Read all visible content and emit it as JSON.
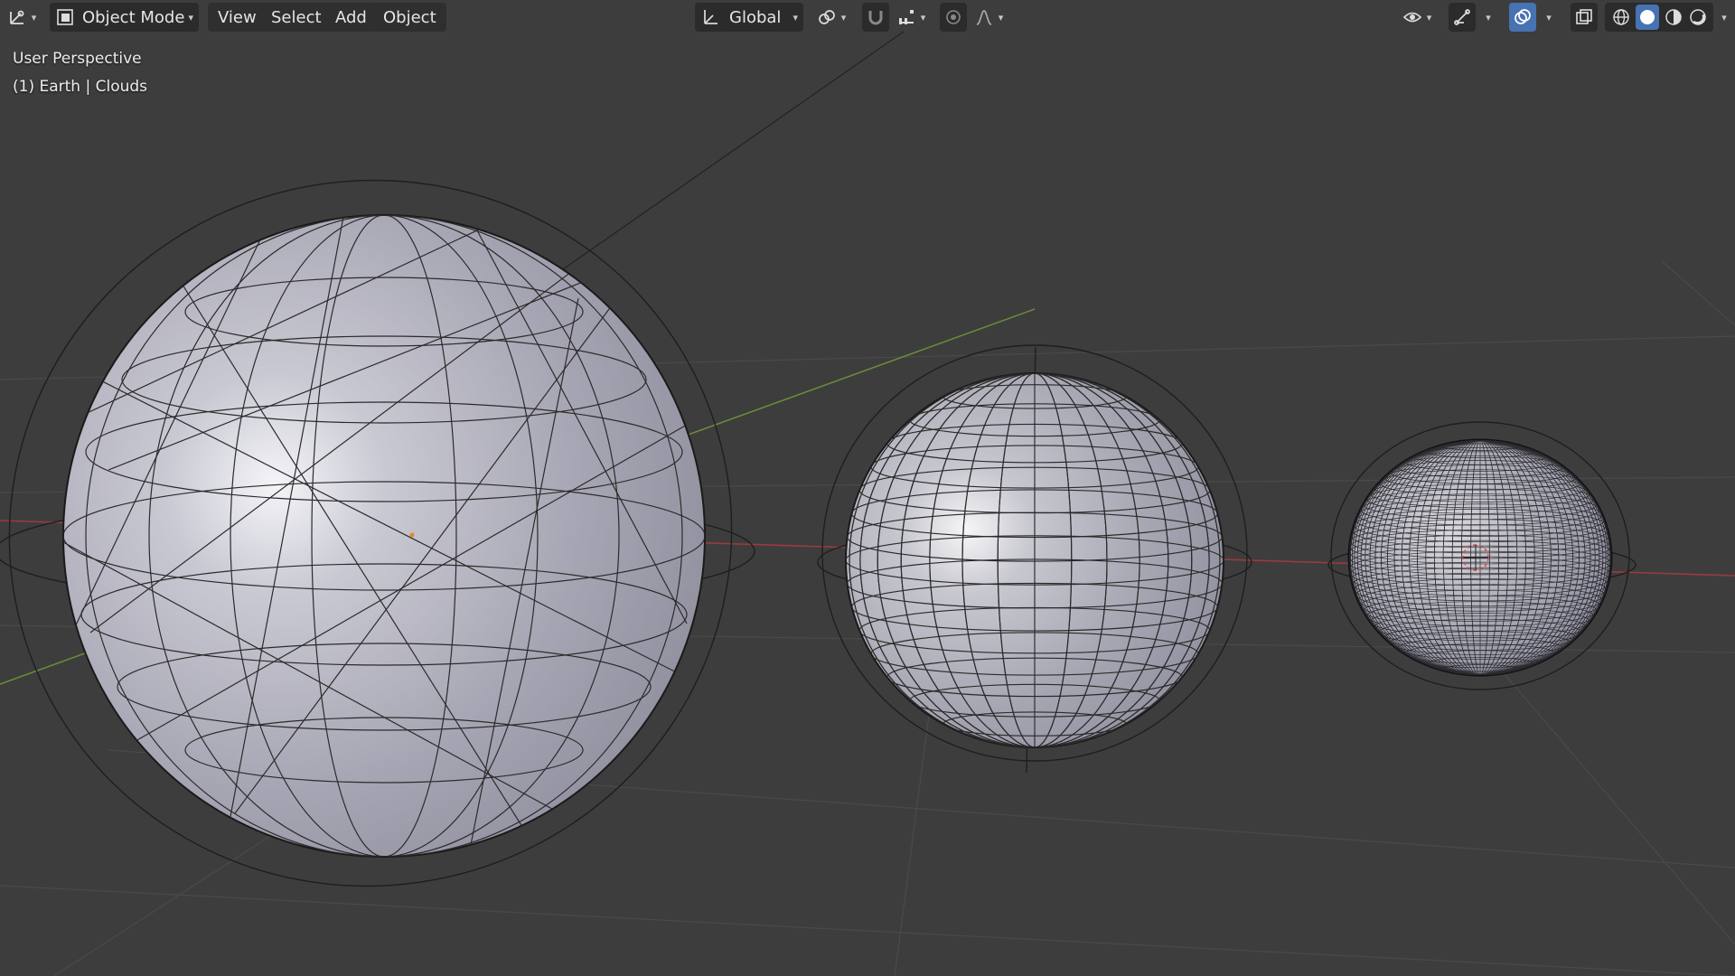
{
  "header": {
    "editor_type_icon": "editor-type-icon",
    "mode": {
      "label": "Object Mode",
      "icon": "object-mode-icon"
    },
    "menus": [
      "View",
      "Select",
      "Add",
      "Object"
    ],
    "orientation": {
      "label": "Global",
      "icon": "transform-orientation-icon"
    },
    "pivot_icon": "pivot-point-icon",
    "snap_icon": "snap-magnet-icon",
    "snap_target_icon": "snap-increment-icon",
    "proportional_icon": "proportional-editing-icon",
    "falloff_icon": "falloff-curve-icon",
    "visibility_icon": "eye-visibility-icon",
    "gizmo_icon": "gizmo-icon",
    "overlays_icon": "overlays-icon",
    "xray_icon": "xray-icon",
    "shading_modes": [
      "wireframe",
      "solid",
      "material-preview",
      "rendered"
    ],
    "active_shading": "solid"
  },
  "viewport": {
    "view_name": "User Perspective",
    "object_info": "(1) Earth | Clouds",
    "colors": {
      "background": "#3d3d3d",
      "x_axis": "#9c3a3f",
      "y_axis": "#6b8e3a",
      "sphere": "#b8b8c4",
      "wire": "#2a2a2a",
      "accent": "#4772b3"
    },
    "objects": [
      {
        "name": "sphere-large",
        "wire_style": "triangulated"
      },
      {
        "name": "sphere-medium",
        "wire_style": "uv-grid"
      },
      {
        "name": "sphere-small",
        "wire_style": "dense-grid"
      }
    ]
  }
}
